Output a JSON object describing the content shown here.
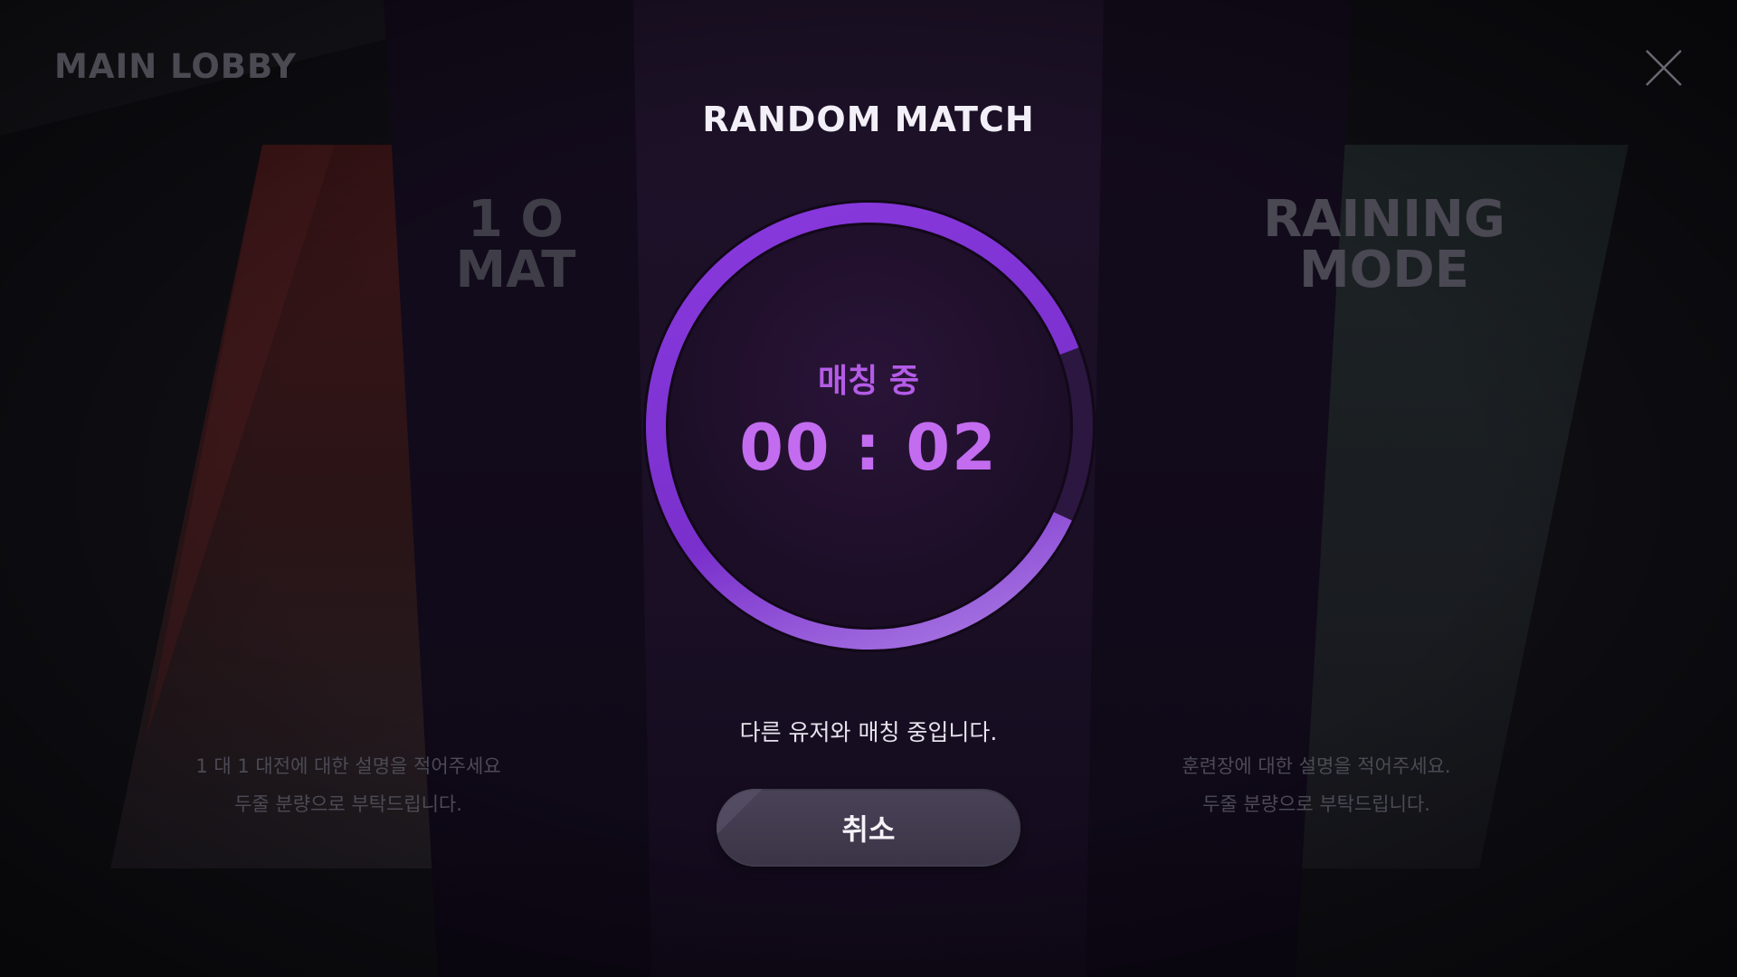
{
  "lobby": {
    "title": "MAIN LOBBY"
  },
  "modes": [
    {
      "title": "1 O\nMAT",
      "description": "1 대 1 대전에 대한 설명을 적어주세요\n두줄 분량으로 부탁드립니다."
    },
    {
      "title": "RAINING\nMODE",
      "description": "훈련장에 대한 설명을 적어주세요.\n두줄 분량으로 부탁드립니다."
    }
  ],
  "modal": {
    "title": "RANDOM MATCH",
    "status_label": "매칭 중",
    "timer": "00 : 02",
    "info_text": "다른 유저와 매칭 중입니다.",
    "cancel_label": "취소"
  },
  "colors": {
    "accent": "#b45ce8",
    "ring": "#7a36d4",
    "panel": "#1c1128"
  },
  "icons": {
    "close": "close-icon"
  }
}
